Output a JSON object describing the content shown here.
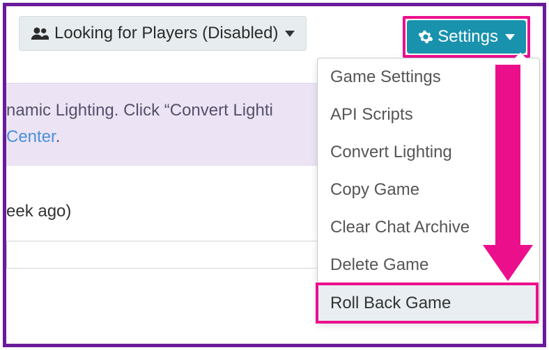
{
  "topbar": {
    "lfp_label": "Looking for Players (Disabled)",
    "settings_label": "Settings"
  },
  "info": {
    "line1_fragment": "namic Lighting. Click “Convert Lighti",
    "line2_link_fragment": "Center",
    "line2_suffix": "."
  },
  "timestamp_fragment": "eek ago)",
  "dropdown": {
    "items": [
      "Game Settings",
      "API Scripts",
      "Convert Lighting",
      "Copy Game",
      "Clear Chat Archive",
      "Delete Game",
      "Roll Back Game"
    ]
  },
  "highlight_item_index": 6
}
